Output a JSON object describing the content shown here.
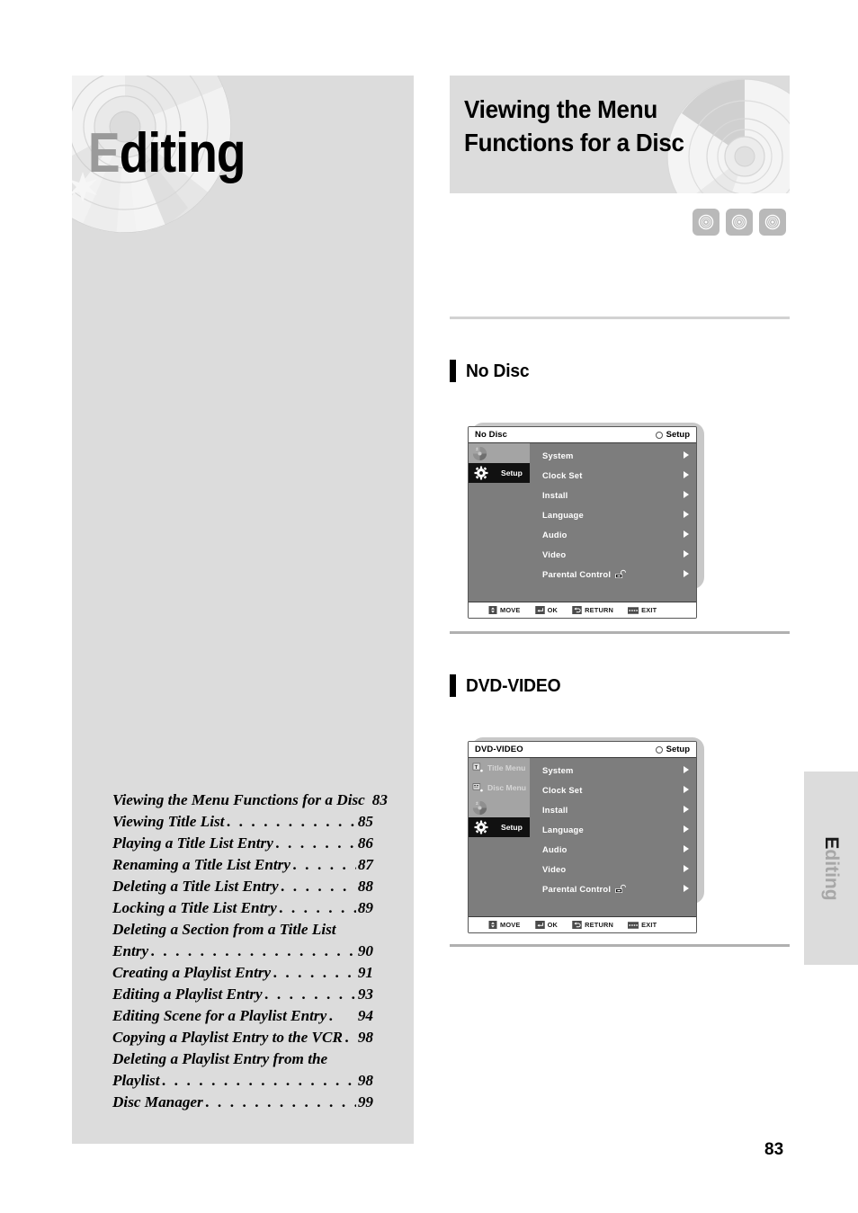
{
  "page": {
    "number": "83",
    "chapter_cap": "E",
    "chapter_rest": "diting",
    "tab_cap": "E",
    "tab_rest": "diting"
  },
  "header": {
    "line1": "Viewing the Menu",
    "line2": "Functions for a Disc",
    "badges": [
      "disc-icon",
      "disc-icon",
      "disc-icon"
    ]
  },
  "toc": {
    "entries": [
      {
        "label": "Viewing the Menu Functions for a Disc",
        "dots": "",
        "page": "83"
      },
      {
        "label": "Viewing Title List",
        "dots": ". . . . . . . . . . . . .",
        "page": "85"
      },
      {
        "label": "Playing a Title List Entry",
        "dots": ". . . . . . . . .",
        "page": "86"
      },
      {
        "label": "Renaming a Title List Entry",
        "dots": ". . . . . . .",
        "page": "87"
      },
      {
        "label": "Deleting a Title List Entry",
        "dots": ". . . . . .",
        "page": "88"
      },
      {
        "label": "Locking a Title List Entry",
        "dots": ". . . . . . .",
        "page": "89"
      },
      {
        "label": "Deleting a Section from a Title List",
        "dots": "",
        "page": ""
      },
      {
        "label": "Entry",
        "dots": ". . . . . . . . . . . . . . . . . . .",
        "page": "90"
      },
      {
        "label": "Creating a Playlist Entry",
        "dots": ". . . . . . . . .",
        "page": "91"
      },
      {
        "label": "Editing a Playlist Entry",
        "dots": ". . . . . . . . .",
        "page": "93"
      },
      {
        "label": "Editing Scene for a Playlist Entry",
        "dots": ".",
        "page": "94"
      },
      {
        "label": "Copying a Playlist Entry to the VCR",
        "dots": ".",
        "page": "98"
      },
      {
        "label": "Deleting a Playlist Entry from the",
        "dots": "",
        "page": ""
      },
      {
        "label": "Playlist",
        "dots": ". . . . . . . . . . . . . . . . . . . .",
        "page": "98"
      },
      {
        "label": "Disc Manager",
        "dots": ". . . . . . . . . . . . . . .",
        "page": "99"
      }
    ]
  },
  "sections": [
    {
      "heading": "No Disc",
      "osd": {
        "disc_state": "No Disc",
        "setup_label": "Setup",
        "sidebar": [
          {
            "label": "",
            "icon": "disc-pie-icon",
            "state": "grayed"
          },
          {
            "label": "Setup",
            "icon": "gear-icon",
            "state": "active"
          }
        ],
        "menu": [
          {
            "label": "System",
            "icon": ""
          },
          {
            "label": "Clock Set",
            "icon": ""
          },
          {
            "label": "Install",
            "icon": ""
          },
          {
            "label": "Language",
            "icon": ""
          },
          {
            "label": "Audio",
            "icon": ""
          },
          {
            "label": "Video",
            "icon": ""
          },
          {
            "label": "Parental Control",
            "icon": "padlock-open-icon"
          }
        ],
        "hints": [
          {
            "key": "updown-arrows-icon",
            "label": "MOVE"
          },
          {
            "key": "enter-key-icon",
            "label": "OK"
          },
          {
            "key": "return-arrow-icon",
            "label": "RETURN"
          },
          {
            "key": "exit-key-icon",
            "label": "EXIT"
          }
        ]
      }
    },
    {
      "heading": "DVD-VIDEO",
      "osd": {
        "disc_state": "DVD-VIDEO",
        "setup_label": "Setup",
        "sidebar": [
          {
            "label": "Title Menu",
            "icon": "title-menu-icon",
            "state": "grayed"
          },
          {
            "label": "Disc Menu",
            "icon": "disc-menu-icon",
            "state": "grayed"
          },
          {
            "label": "",
            "icon": "disc-pie-icon",
            "state": "grayed"
          },
          {
            "label": "Setup",
            "icon": "gear-icon",
            "state": "active"
          }
        ],
        "menu": [
          {
            "label": "System",
            "icon": ""
          },
          {
            "label": "Clock Set",
            "icon": ""
          },
          {
            "label": "Install",
            "icon": ""
          },
          {
            "label": "Language",
            "icon": ""
          },
          {
            "label": "Audio",
            "icon": ""
          },
          {
            "label": "Video",
            "icon": ""
          },
          {
            "label": "Parental Control",
            "icon": "padlock-open-icon"
          }
        ],
        "hints": [
          {
            "key": "updown-arrows-icon",
            "label": "MOVE"
          },
          {
            "key": "enter-key-icon",
            "label": "OK"
          },
          {
            "key": "return-arrow-icon",
            "label": "RETURN"
          },
          {
            "key": "exit-key-icon",
            "label": "EXIT"
          }
        ]
      }
    }
  ],
  "colors": {
    "panel_gray": "#dcdcdc",
    "osd_body": "#7d7d7d",
    "osd_active": "#111111",
    "rule": "#b0b0b0"
  }
}
